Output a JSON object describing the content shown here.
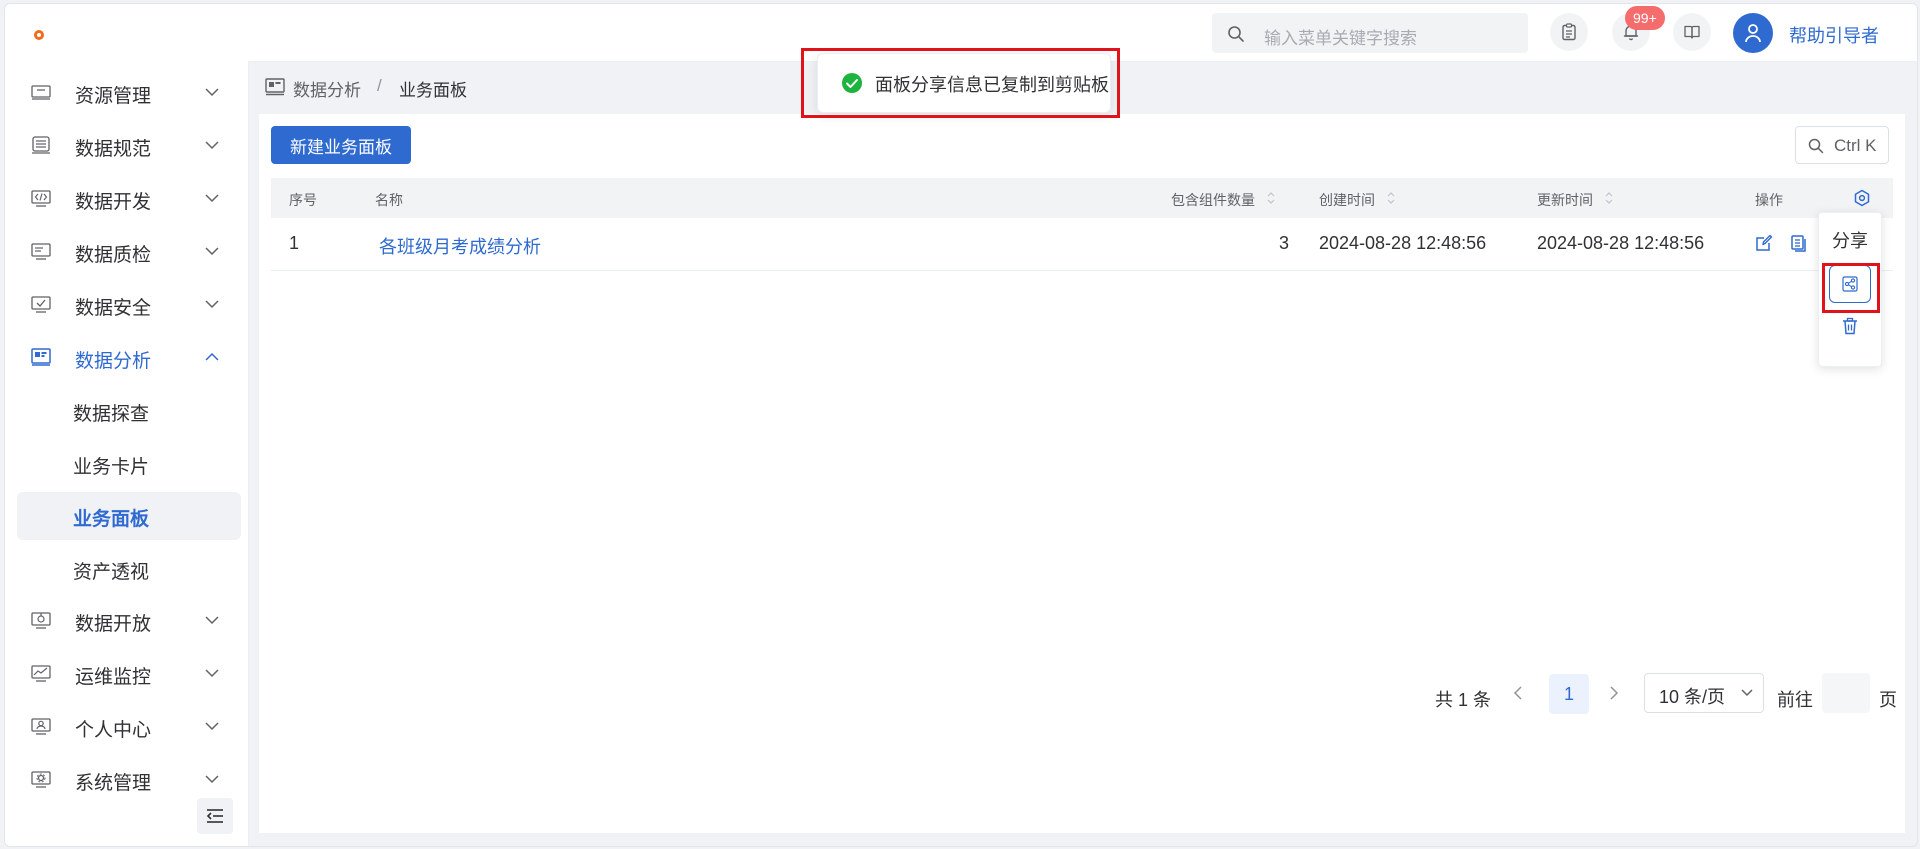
{
  "header": {
    "search_placeholder": "输入菜单关键字搜索",
    "notification_badge": "99+",
    "username": "帮助引导者"
  },
  "sidebar": {
    "items": [
      {
        "label": "资源管理",
        "icon": "server-icon",
        "expanded": false
      },
      {
        "label": "数据规范",
        "icon": "database-icon",
        "expanded": false
      },
      {
        "label": "数据开发",
        "icon": "code-icon",
        "expanded": false
      },
      {
        "label": "数据质检",
        "icon": "inspect-icon",
        "expanded": false
      },
      {
        "label": "数据安全",
        "icon": "shield-check-icon",
        "expanded": false
      },
      {
        "label": "数据分析",
        "icon": "chart-board-icon",
        "expanded": true
      },
      {
        "label": "数据开放",
        "icon": "open-data-icon",
        "expanded": false
      },
      {
        "label": "运维监控",
        "icon": "monitor-line-icon",
        "expanded": false
      },
      {
        "label": "个人中心",
        "icon": "user-card-icon",
        "expanded": false
      },
      {
        "label": "系统管理",
        "icon": "settings-icon",
        "expanded": false
      }
    ],
    "sub_items": [
      {
        "label": "数据探查"
      },
      {
        "label": "业务卡片"
      },
      {
        "label": "业务面板"
      },
      {
        "label": "资产透视"
      }
    ],
    "selected_sub": "业务面板"
  },
  "breadcrumb": {
    "parent": "数据分析",
    "separator": "/",
    "current": "业务面板"
  },
  "toolbar": {
    "new_button": "新建业务面板",
    "shortcut": "Ctrl K"
  },
  "table": {
    "columns": {
      "index": "序号",
      "name": "名称",
      "component_count": "包含组件数量",
      "created": "创建时间",
      "updated": "更新时间",
      "actions": "操作"
    },
    "rows": [
      {
        "index": "1",
        "name": "各班级月考成绩分析",
        "component_count": "3",
        "created": "2024-08-28 12:48:56",
        "updated": "2024-08-28 12:48:56"
      }
    ]
  },
  "pagination": {
    "total": "共 1 条",
    "current_page": "1",
    "page_size": "10 条/页",
    "goto_label": "前往",
    "goto_unit": "页"
  },
  "popover": {
    "title": "分享"
  },
  "toast": {
    "message": "面板分享信息已复制到剪贴板"
  },
  "colors": {
    "primary": "#2f6ad0",
    "success": "#1db33f",
    "danger": "#f56c6c",
    "highlight": "#e0131b"
  }
}
